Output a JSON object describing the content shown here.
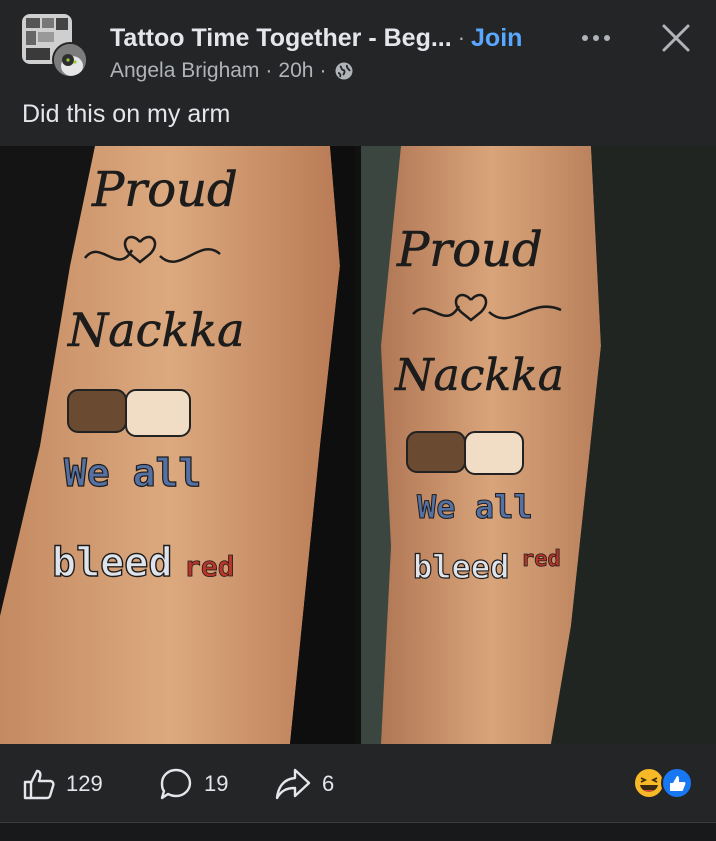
{
  "header": {
    "group_name": "Tattoo Time Together - Beg...",
    "separator": "·",
    "join_label": "Join",
    "author": "Angela Brigham",
    "time": "20h",
    "meta_dot": "·",
    "privacy_icon": "globe-icon",
    "more_icon": "more-horizontal-icon",
    "close_icon": "close-icon"
  },
  "post": {
    "text": "Did this on my arm"
  },
  "photos": {
    "left": {
      "words": [
        "Proud",
        "Nackka",
        "We all",
        "bleed",
        "red"
      ]
    },
    "right": {
      "words": [
        "Proud",
        "Nackka",
        "We all",
        "bleed",
        "red"
      ]
    }
  },
  "actions": {
    "like_icon": "thumbs-up-icon",
    "like_count": "129",
    "comment_icon": "comment-icon",
    "comment_count": "19",
    "share_icon": "share-icon",
    "share_count": "6"
  },
  "reactions": {
    "icons": [
      "haha-reaction-icon",
      "like-reaction-icon"
    ]
  },
  "colors": {
    "background": "#242526",
    "text": "#e4e6eb",
    "secondary_text": "#b0b3b8",
    "join_link": "#5aa7ff",
    "like_reaction": "#1877f2",
    "haha_reaction": "#f7b928"
  }
}
